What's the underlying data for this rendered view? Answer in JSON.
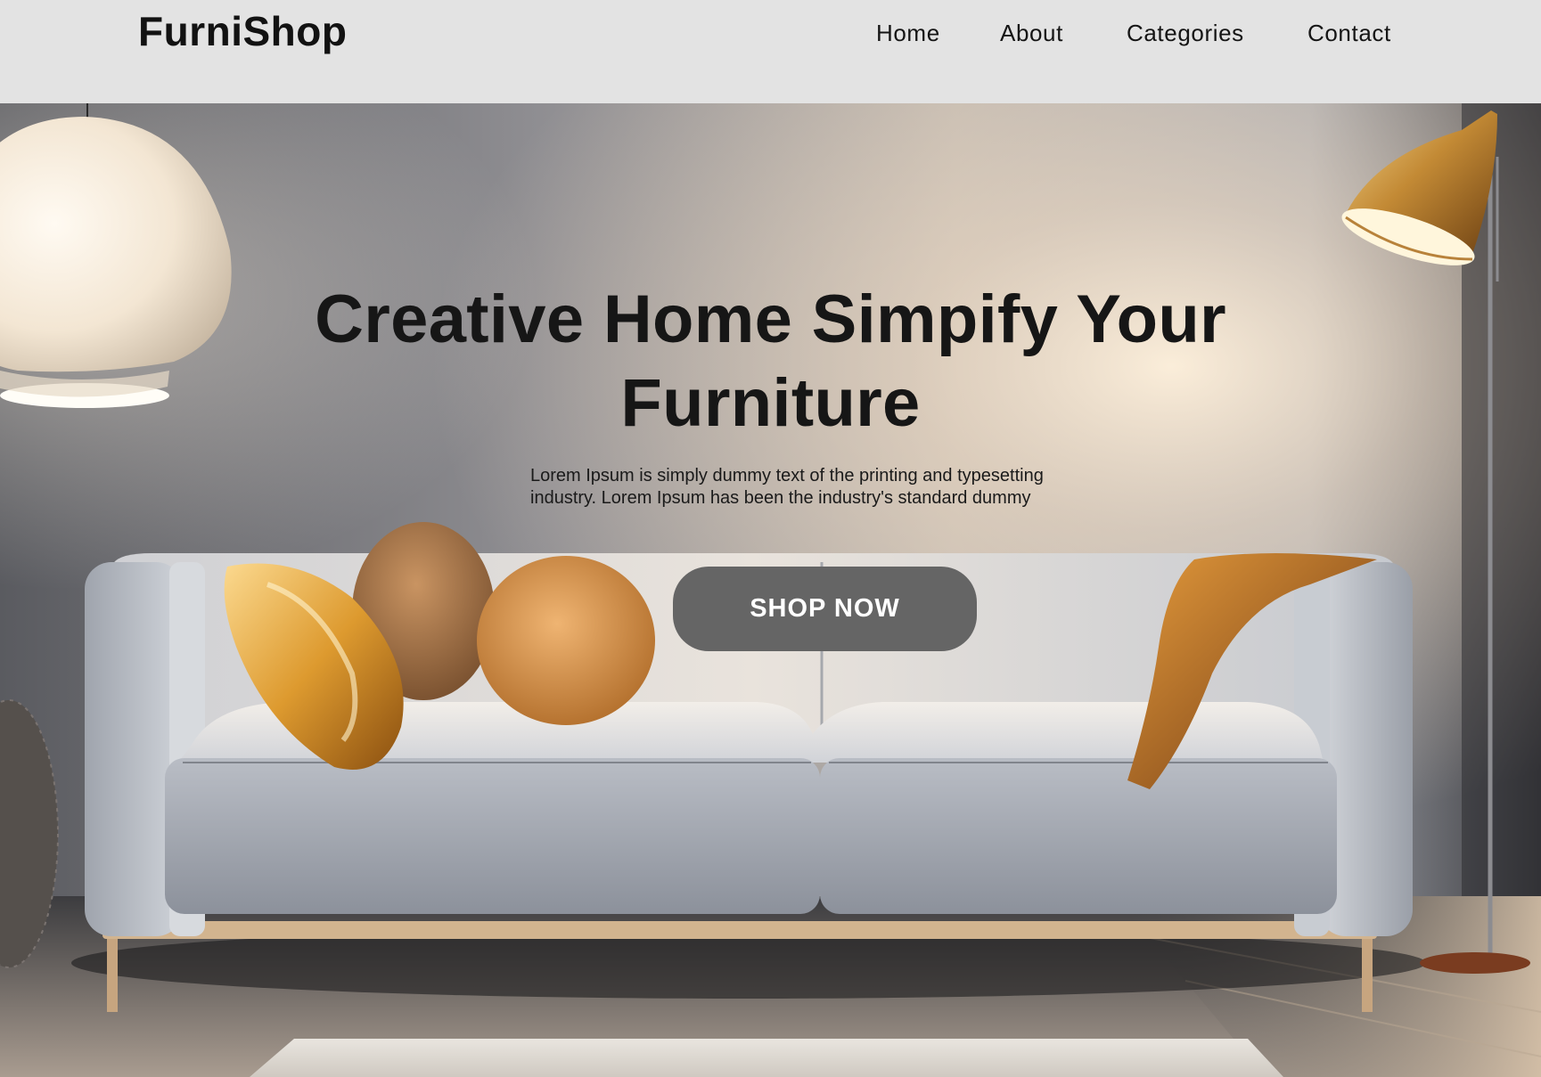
{
  "header": {
    "brand": "FurniShop",
    "nav": [
      {
        "label": "Home"
      },
      {
        "label": "About"
      },
      {
        "label": "Categories"
      },
      {
        "label": "Contact"
      }
    ]
  },
  "hero": {
    "title_line1": "Creative Home Simpify Your",
    "title_line2": "Furniture",
    "description_line1": "Lorem Ipsum is simply dummy text of the printing and typesetting",
    "description_line2": "industry. Lorem Ipsum has been the industry's standard dummy",
    "button_label": "SHOP NOW"
  },
  "colors": {
    "header_bg": "#e3e3e3",
    "button_bg": "#656565",
    "title_text": "#161616",
    "accent_gold": "#d9942e"
  },
  "icons": {
    "pendant_lamp": "pendant-lamp-icon",
    "floor_lamp": "floor-lamp-icon",
    "sofa": "sofa-illustration"
  }
}
